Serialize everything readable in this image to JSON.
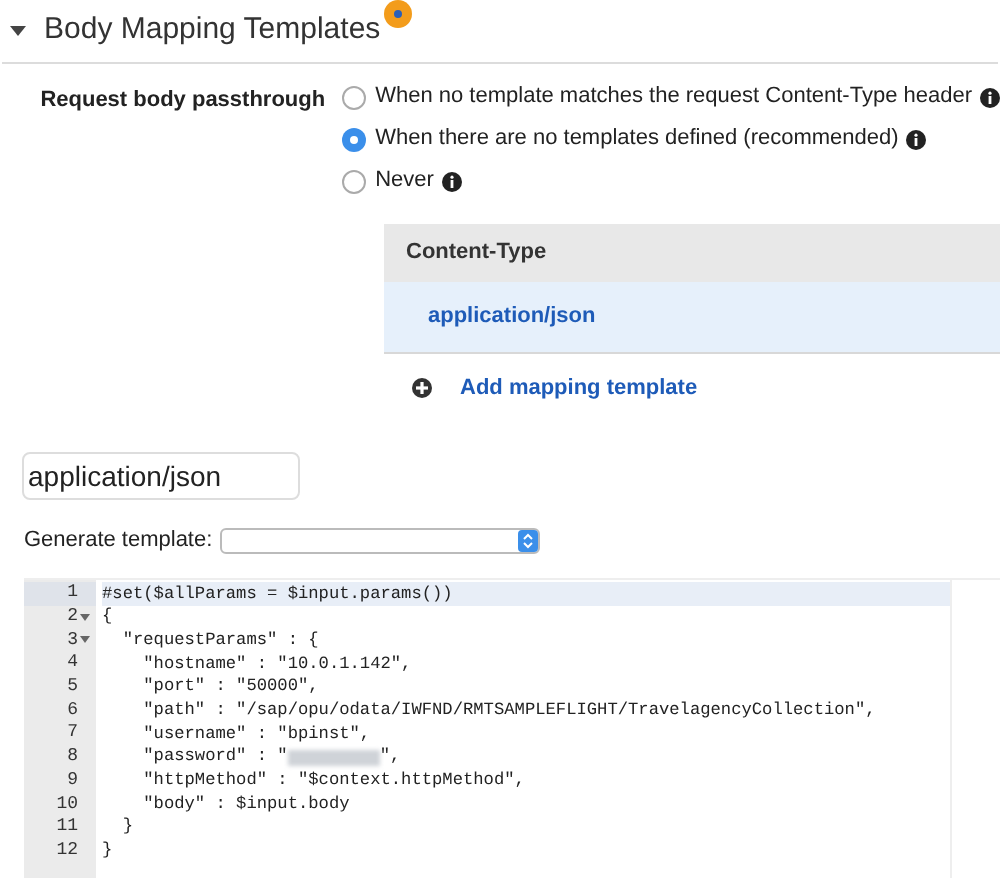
{
  "section": {
    "title": "Body Mapping Templates",
    "expanded": true
  },
  "passthrough": {
    "label": "Request body passthrough",
    "options": [
      {
        "label": "When no template matches the request Content-Type header",
        "selected": false
      },
      {
        "label": "When there are no templates defined (recommended)",
        "selected": true
      },
      {
        "label": "Never",
        "selected": false
      }
    ]
  },
  "content_types": {
    "header": "Content-Type",
    "rows": [
      {
        "value": "application/json",
        "selected": true
      }
    ],
    "add_link": "Add mapping template"
  },
  "template_name": {
    "value": "application/json"
  },
  "generate_template": {
    "label": "Generate template:"
  },
  "editor": {
    "lines": [
      {
        "number": "1",
        "code": "#set($allParams = $input.params())",
        "foldable": false,
        "active": true,
        "redacted": false
      },
      {
        "number": "2",
        "code": "{",
        "foldable": true,
        "active": false,
        "redacted": false
      },
      {
        "number": "3",
        "code": "  \"requestParams\" : {",
        "foldable": true,
        "active": false,
        "redacted": false
      },
      {
        "number": "4",
        "code": "    \"hostname\" : \"10.0.1.142\",",
        "foldable": false,
        "active": false,
        "redacted": false
      },
      {
        "number": "5",
        "code": "    \"port\" : \"50000\",",
        "foldable": false,
        "active": false,
        "redacted": false
      },
      {
        "number": "6",
        "code": "    \"path\" : \"/sap/opu/odata/IWFND/RMTSAMPLEFLIGHT/TravelagencyCollection\",",
        "foldable": false,
        "active": false,
        "redacted": false
      },
      {
        "number": "7",
        "code": "    \"username\" : \"bpinst\",",
        "foldable": false,
        "active": false,
        "redacted": false
      },
      {
        "number": "8",
        "code": "    \"password\" : \"",
        "code_after": "\",",
        "foldable": false,
        "active": false,
        "redacted": true
      },
      {
        "number": "9",
        "code": "    \"httpMethod\" : \"$context.httpMethod\",",
        "foldable": false,
        "active": false,
        "redacted": false
      },
      {
        "number": "10",
        "code": "    \"body\" : $input.body",
        "foldable": false,
        "active": false,
        "redacted": false
      },
      {
        "number": "11",
        "code": "  }",
        "foldable": false,
        "active": false,
        "redacted": false
      },
      {
        "number": "12",
        "code": "}",
        "foldable": false,
        "active": false,
        "redacted": false
      }
    ]
  }
}
